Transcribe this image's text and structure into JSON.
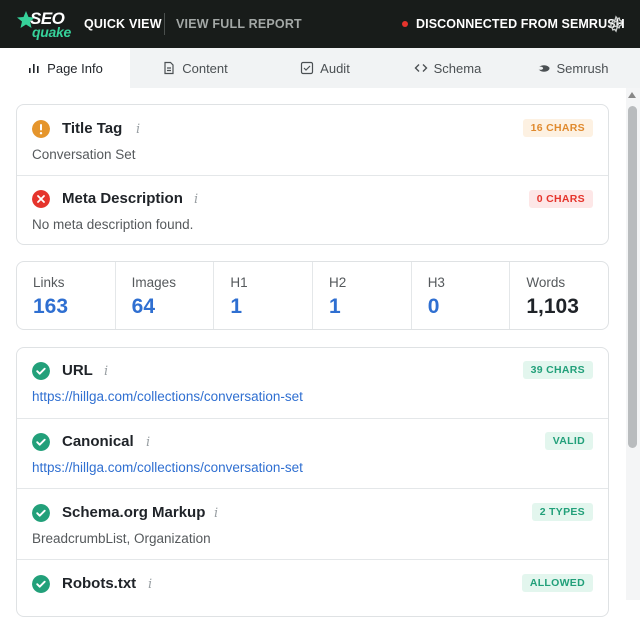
{
  "header": {
    "logo_seo": "SEO",
    "logo_quake": "quake",
    "nav_quick_view": "QUICK VIEW",
    "nav_full_report": "VIEW FULL REPORT",
    "status_text": "DISCONNECTED FROM SEMRUSH",
    "status_color": "#e5342c"
  },
  "tabs": [
    {
      "label": "Page Info",
      "icon": "bar-chart-icon",
      "active": true
    },
    {
      "label": "Content",
      "icon": "document-icon",
      "active": false
    },
    {
      "label": "Audit",
      "icon": "checkbox-icon",
      "active": false
    },
    {
      "label": "Schema",
      "icon": "code-icon",
      "active": false
    },
    {
      "label": "Semrush",
      "icon": "semrush-icon",
      "active": false
    }
  ],
  "meta_card": {
    "title_tag": {
      "title": "Title Tag",
      "info": "i",
      "badge": "16 CHARS",
      "value": "Conversation Set",
      "status": "warning"
    },
    "meta_description": {
      "title": "Meta Description",
      "info": "i",
      "badge": "0 CHARS",
      "value": "No meta description found.",
      "status": "error"
    }
  },
  "stats": [
    {
      "label": "Links",
      "value": "163"
    },
    {
      "label": "Images",
      "value": "64"
    },
    {
      "label": "H1",
      "value": "1"
    },
    {
      "label": "H2",
      "value": "1"
    },
    {
      "label": "H3",
      "value": "0"
    },
    {
      "label": "Words",
      "value": "1,103"
    }
  ],
  "checks_card": {
    "url": {
      "title": "URL",
      "info": "i",
      "badge": "39 CHARS",
      "value": "https://hillga.com/collections/conversation-set"
    },
    "canonical": {
      "title": "Canonical",
      "info": "i",
      "badge": "VALID",
      "value": "https://hillga.com/collections/conversation-set"
    },
    "schema": {
      "title": "Schema.org Markup",
      "info": "i",
      "badge": "2 TYPES",
      "value": "BreadcrumbList, Organization"
    },
    "robots": {
      "title": "Robots.txt",
      "info": "i",
      "badge": "ALLOWED"
    }
  },
  "colors": {
    "accent": "#2f6fd1",
    "ok": "#22a07a",
    "warning": "#e5952c",
    "error": "#e5342c"
  }
}
